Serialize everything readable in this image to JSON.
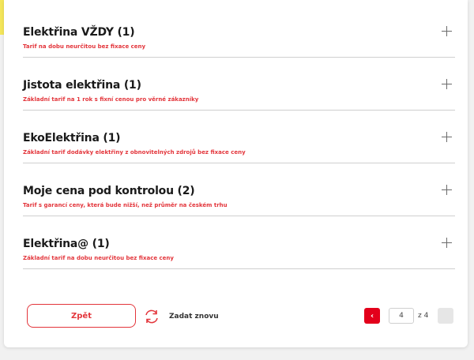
{
  "tariffs": [
    {
      "title": "Elektřina VŽDY (1)",
      "subtitle": "Tarif na dobu neurčitou bez fixace ceny"
    },
    {
      "title": "Jistota elektřina (1)",
      "subtitle": "Základní tarif na 1 rok s fixní cenou pro věrné zákazníky"
    },
    {
      "title": "EkoElektřina (1)",
      "subtitle": "Základní tarif dodávky elektřiny z obnovitelných zdrojů bez fixace ceny"
    },
    {
      "title": "Moje cena pod kontrolou (2)",
      "subtitle": "Tarif s garancí ceny, která bude nižší, než průměr na českém trhu"
    },
    {
      "title": "Elektřina@ (1)",
      "subtitle": "Základní tarif na dobu neurčitou bez fixace ceny"
    }
  ],
  "footer": {
    "back_label": "Zpět",
    "reset_label": "Zadat znovu",
    "current_page": "4",
    "total_pages": "z 4",
    "prev_arrow": "‹"
  },
  "colors": {
    "accent": "#e3001b",
    "subtitle": "#e3353b"
  }
}
